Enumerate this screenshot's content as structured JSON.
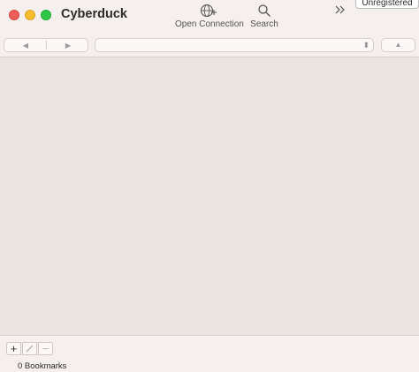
{
  "window": {
    "title": "Cyberduck"
  },
  "toolbar": {
    "open_connection_label": "Open Connection",
    "search_label": "Search",
    "overflow_glyph": "»",
    "unregistered_label": "Unregistered"
  },
  "navigation": {
    "back_glyph": "◀",
    "forward_glyph": "▶",
    "path_value": "",
    "path_chevron_glyph": "⬍",
    "up_glyph": "▲"
  },
  "bookmarks": {
    "add_glyph": "+",
    "edit_glyph": "✎",
    "delete_glyph": "−",
    "status_text": "0 Bookmarks"
  },
  "colors": {
    "background": "#ece4e1",
    "toolbar": "#f5efed",
    "close": "#ee5f57",
    "minimize": "#f7bd2f",
    "maximize": "#2fc748"
  }
}
